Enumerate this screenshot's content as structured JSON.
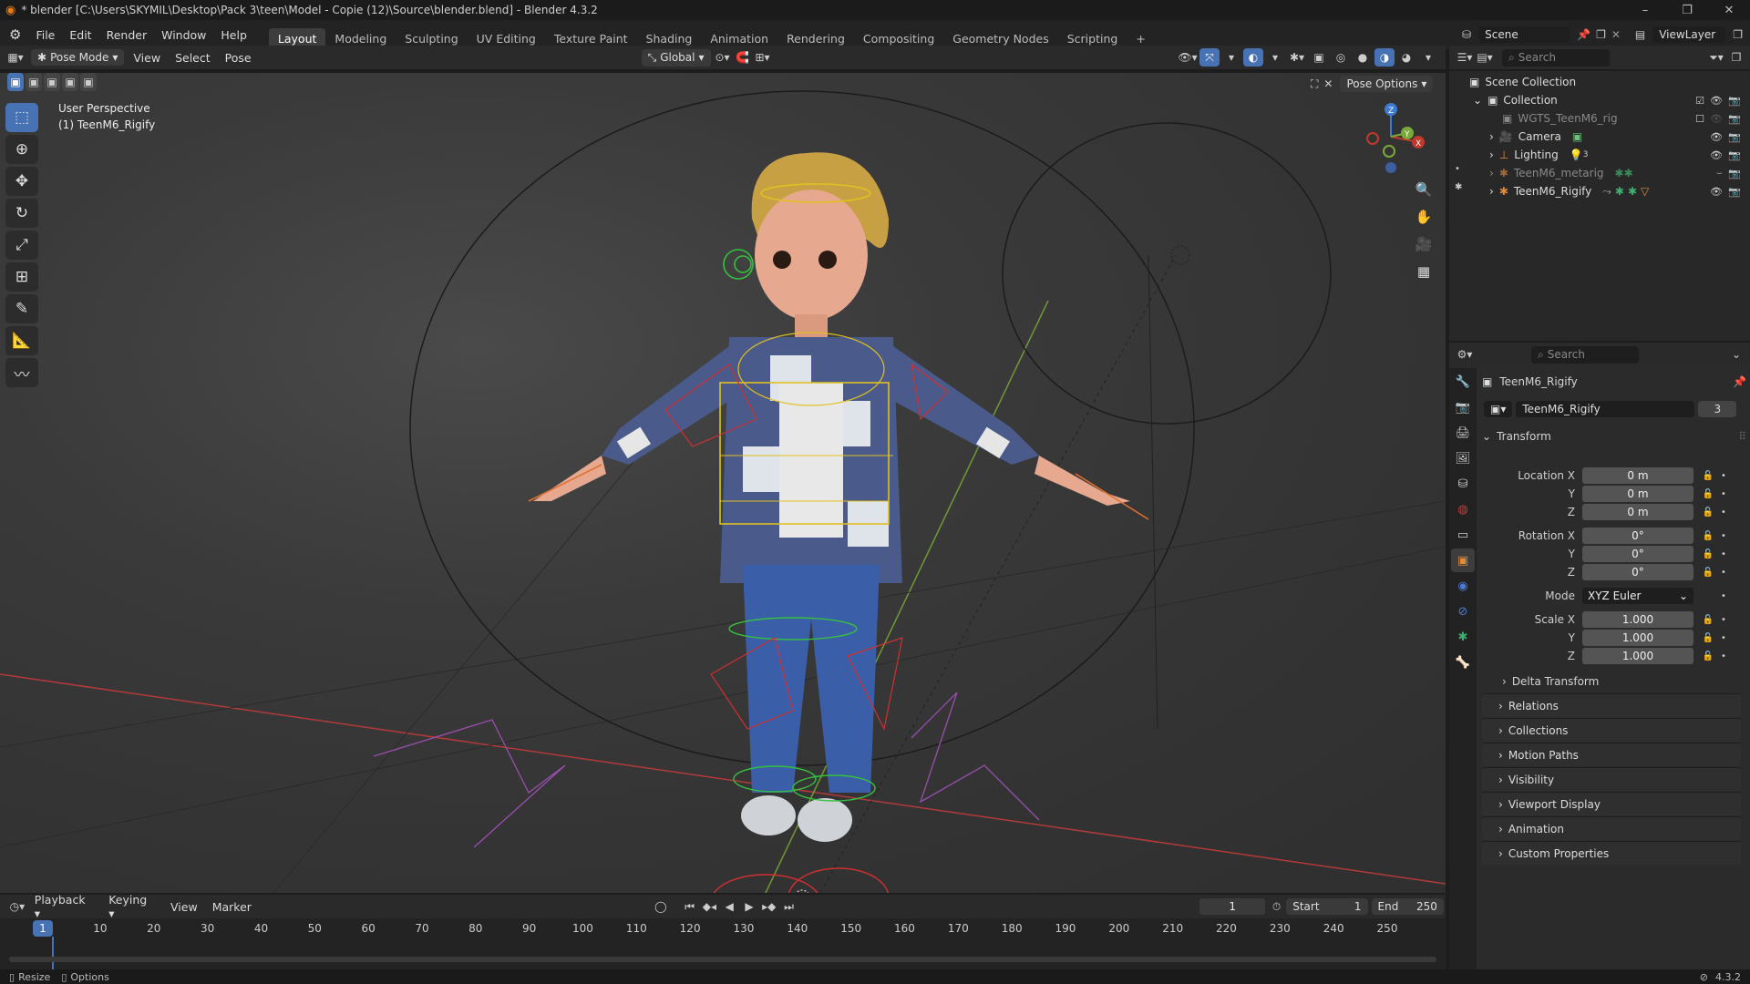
{
  "title_bar": {
    "title": "* blender [C:\\Users\\SKYMIL\\Desktop\\Pack 3\\teen\\Model - Copie (12)\\Source\\blender.blend] - Blender 4.3.2",
    "min": "–",
    "max": "❐",
    "close": "✕"
  },
  "menu": [
    "File",
    "Edit",
    "Render",
    "Window",
    "Help"
  ],
  "workspaces": [
    "Layout",
    "Modeling",
    "Sculpting",
    "UV Editing",
    "Texture Paint",
    "Shading",
    "Animation",
    "Rendering",
    "Compositing",
    "Geometry Nodes",
    "Scripting",
    "+"
  ],
  "active_workspace": "Layout",
  "scene": {
    "name": "Scene",
    "view_layer": "ViewLayer"
  },
  "viewport_header": {
    "mode": "Pose Mode",
    "menus": [
      "View",
      "Select",
      "Pose"
    ],
    "transform_orientation": "Global",
    "pose_options": "Pose Options"
  },
  "viewport": {
    "perspective_label": "User Perspective",
    "object_label": "(1) TeenM6_Rigify"
  },
  "outliner": {
    "search_placeholder": "Search",
    "root": "Scene Collection",
    "collection": "Collection",
    "items": [
      {
        "name": "WGTS_TeenM6_rig",
        "dim": true
      },
      {
        "name": "Camera",
        "dim": false
      },
      {
        "name": "Lighting",
        "dim": false
      },
      {
        "name": "TeenM6_metarig",
        "dim": true
      },
      {
        "name": "TeenM6_Rigify",
        "dim": false
      }
    ],
    "lighting_badge": "3"
  },
  "properties": {
    "search_placeholder": "Search",
    "object_name": "TeenM6_Rigify",
    "data_name": "TeenM6_Rigify",
    "users": "3",
    "transform_title": "Transform",
    "location": {
      "label": "Location X",
      "x": "0 m",
      "y": "0 m",
      "z": "0 m"
    },
    "rotation": {
      "label": "Rotation X",
      "x": "0°",
      "y": "0°",
      "z": "0°"
    },
    "mode_label": "Mode",
    "mode_value": "XYZ Euler",
    "scale": {
      "label": "Scale X",
      "x": "1.000",
      "y": "1.000",
      "z": "1.000"
    },
    "axis_y": "Y",
    "axis_z": "Z",
    "delta_transform": "Delta Transform",
    "panels": [
      "Relations",
      "Collections",
      "Motion Paths",
      "Visibility",
      "Viewport Display",
      "Animation",
      "Custom Properties"
    ]
  },
  "timeline": {
    "menus": [
      "Playback",
      "Keying",
      "View",
      "Marker"
    ],
    "current_frame": "1",
    "start_label": "Start",
    "start": "1",
    "end_label": "End",
    "end": "250",
    "ticks": [
      "1",
      "10",
      "20",
      "30",
      "40",
      "50",
      "60",
      "70",
      "80",
      "90",
      "100",
      "110",
      "120",
      "130",
      "140",
      "150",
      "160",
      "170",
      "180",
      "190",
      "200",
      "210",
      "220",
      "230",
      "240",
      "250"
    ]
  },
  "status": {
    "resize": "Resize",
    "options": "Options",
    "version": "4.3.2"
  },
  "colors": {
    "accent": "#4772b3",
    "x_axis": "#c0392b",
    "y_axis": "#7aa93a",
    "z_axis": "#3d7ad4"
  }
}
